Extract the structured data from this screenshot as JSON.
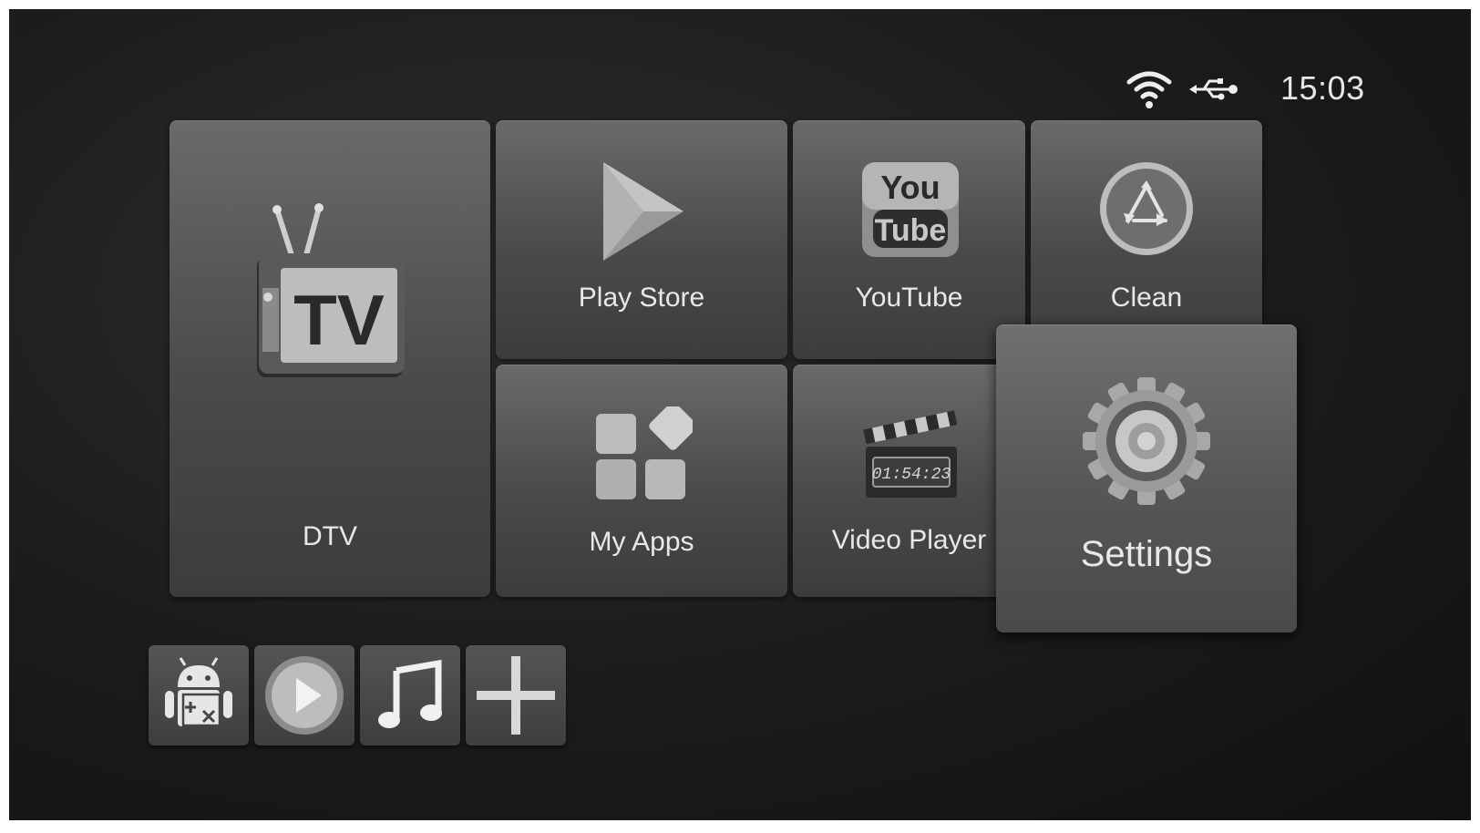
{
  "status_bar": {
    "wifi_icon": "wifi-icon",
    "usb_icon": "usb-icon",
    "time": "15:03"
  },
  "tiles": {
    "dtv": {
      "label": "DTV",
      "icon": "tv-icon",
      "icon_text": "TV"
    },
    "play_store": {
      "label": "Play Store",
      "icon": "play-store-icon"
    },
    "youtube": {
      "label": "YouTube",
      "icon": "youtube-icon",
      "icon_top": "You",
      "icon_bottom": "Tube"
    },
    "clean": {
      "label": "Clean",
      "icon": "recycle-icon"
    },
    "my_apps": {
      "label": "My Apps",
      "icon": "apps-grid-icon"
    },
    "video_player": {
      "label": "Video Player",
      "icon": "clapperboard-icon",
      "icon_text": "01:54:23"
    },
    "settings": {
      "label": "Settings",
      "icon": "gear-icon",
      "focused": true
    }
  },
  "shortcuts": [
    {
      "name": "android-tools",
      "icon": "android-icon"
    },
    {
      "name": "media-player",
      "icon": "play-circle-icon"
    },
    {
      "name": "music",
      "icon": "music-note-icon"
    },
    {
      "name": "add",
      "icon": "plus-icon"
    }
  ]
}
